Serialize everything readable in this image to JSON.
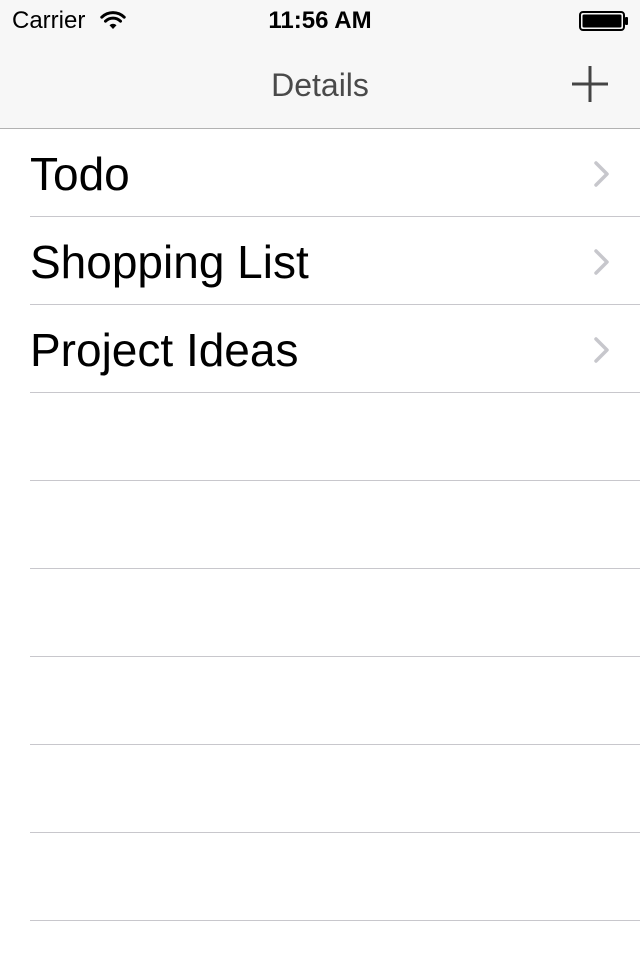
{
  "status_bar": {
    "carrier": "Carrier",
    "time": "11:56 AM",
    "icons": [
      "wifi-icon",
      "battery-icon"
    ]
  },
  "nav_bar": {
    "title": "Details",
    "right_button_icon": "plus-icon"
  },
  "list": {
    "items": [
      {
        "label": "Todo",
        "accessory": "chevron-right-icon"
      },
      {
        "label": "Shopping List",
        "accessory": "chevron-right-icon"
      },
      {
        "label": "Project Ideas",
        "accessory": "chevron-right-icon"
      }
    ],
    "empty_rows": 6
  },
  "colors": {
    "bar_background": "#f7f7f7",
    "separator": "#c8c7cc",
    "chevron": "#c7c7cc",
    "title_text": "#4a4a4a"
  }
}
